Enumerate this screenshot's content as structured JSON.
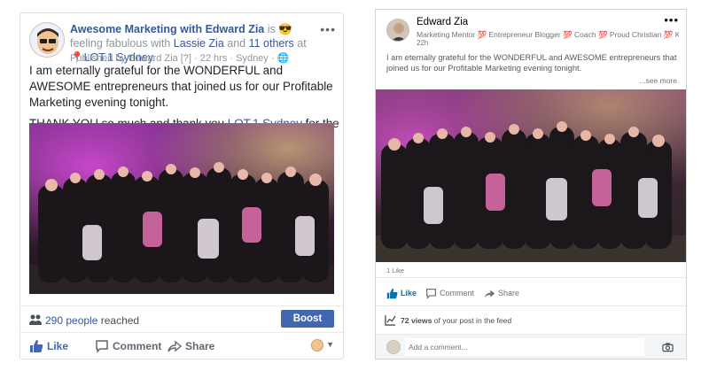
{
  "facebook": {
    "author": "Awesome Marketing with Edward Zia",
    "is_label": "is",
    "emoji": "😎",
    "feeling_label": "feeling",
    "feeling": "fabulous",
    "with_label": "with",
    "tagged": "Lassie Zia",
    "and_label": "and",
    "others": "11 others",
    "at_label": "at",
    "location": "LOT.1 Sydney",
    "published_by": "Published by Edward Zia [?]",
    "time": "22 hrs",
    "place": "Sydney",
    "body_line1": "I am eternally grateful for the WONDERFUL and AWESOME entrepreneurs that joined us for our Profitable Marketing evening tonight.",
    "body2_pre": "THANK YOU so much and thank you",
    "body2_link": "LOT.1 Sydney",
    "body2_post": "for the wonderful venue. Love your work and till next fortnight!",
    "reach_count": "290 people",
    "reach_label": "reached",
    "boost_label": "Boost Post",
    "like_label": "Like",
    "comment_label": "Comment",
    "share_label": "Share",
    "more_icon": "more-horizontal-icon",
    "colors": {
      "link": "#365899",
      "boost": "#4267b2"
    }
  },
  "linkedin": {
    "author": "Edward Zia",
    "headline": "Marketing Mentor 💯 Entrepreneur Blogger 💯 Coach 💯 Proud Christian 💯 Knig...",
    "time": "22h",
    "body": "I am eternally grateful for the WONDERFUL and AWESOME entrepreneurs that joined us for our Profitable Marketing evening tonight.",
    "see_more": "...see more",
    "likes": "1 Like",
    "like_label": "Like",
    "comment_label": "Comment",
    "share_label": "Share",
    "views_count": "72 views",
    "views_label": "of your post in the feed",
    "comment_placeholder": "Add a comment...",
    "colors": {
      "accent": "#0073b1"
    }
  }
}
